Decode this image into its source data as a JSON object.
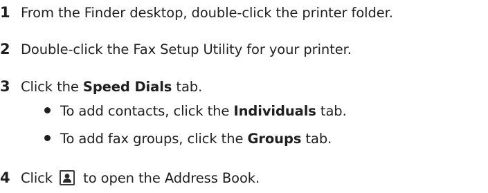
{
  "steps": [
    {
      "num": "1",
      "text": "From the Finder desktop, double-click the printer folder."
    },
    {
      "num": "2",
      "text": "Double-click the Fax Setup Utility for your printer."
    },
    {
      "num": "3",
      "prefix": "Click the ",
      "bold": "Speed Dials",
      "suffix": " tab."
    },
    {
      "num": "4",
      "prefix": "Click ",
      "suffix": " to open the Address Book.",
      "icon": "address-book-person-icon"
    }
  ],
  "bullets": [
    {
      "prefix": "To add contacts, click the ",
      "bold": "Individuals",
      "suffix": " tab."
    },
    {
      "prefix": "To add fax groups, click the ",
      "bold": "Groups",
      "suffix": " tab."
    }
  ]
}
